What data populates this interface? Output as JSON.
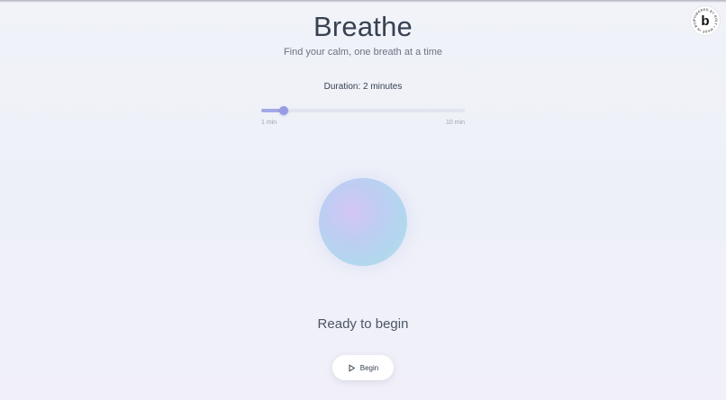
{
  "app": {
    "title": "Breathe",
    "subtitle": "Find your calm, one breath at a time"
  },
  "duration": {
    "label": "Duration: 2 minutes",
    "value_minutes": 2,
    "min_minutes": 1,
    "max_minutes": 10,
    "min_label": "1 min",
    "max_label": "10 min"
  },
  "session": {
    "status": "Ready to begin",
    "begin_label": "Begin",
    "begin_icon": "play-icon"
  },
  "badge": {
    "logo_letter": "b",
    "ring_text": "POWERED BY BOLT • MADE IN BOLT • ",
    "icon": "bolt-badge-icon"
  },
  "colors": {
    "accent": "#979ce3",
    "accent_fill": "#a3a8e6",
    "track": "#e2e4ee",
    "title": "#374151"
  }
}
